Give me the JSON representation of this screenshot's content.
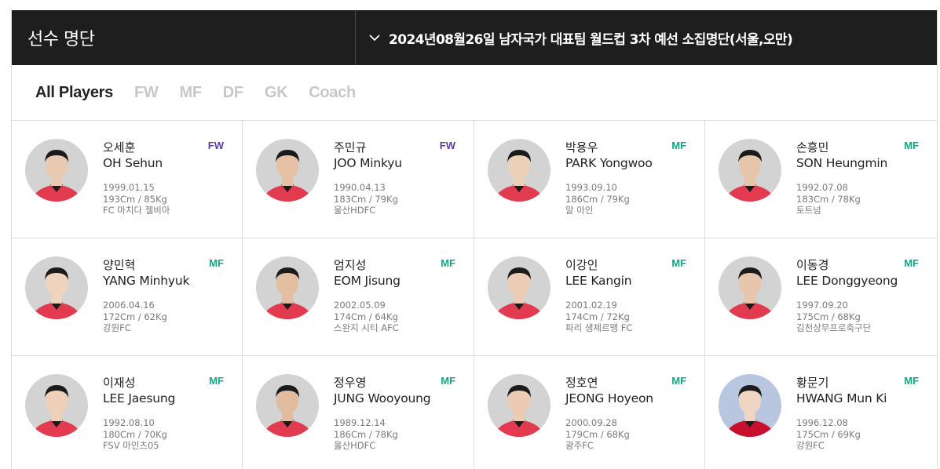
{
  "header": {
    "title": "선수 명단",
    "selected_roster": "2024년08월26일 남자국가 대표팀 월드컵 3차 예선 소집명단(서울,오만)"
  },
  "tabs": [
    "All Players",
    "FW",
    "MF",
    "DF",
    "GK",
    "Coach"
  ],
  "colors": {
    "fw": "#5b3fa0",
    "mf": "#11a683",
    "header_bg": "#1e1e1e"
  },
  "players": [
    {
      "name_ko": "오세훈",
      "name_en": "OH Sehun",
      "birth": "1999.01.15",
      "body": "193Cm / 85Kg",
      "club": "FC 마치다 젤비아",
      "position": "FW"
    },
    {
      "name_ko": "주민규",
      "name_en": "JOO Minkyu",
      "birth": "1990.04.13",
      "body": "183Cm / 79Kg",
      "club": "울산HDFC",
      "position": "FW"
    },
    {
      "name_ko": "박용우",
      "name_en": "PARK Yongwoo",
      "birth": "1993.09.10",
      "body": "186Cm / 79Kg",
      "club": "알 아인",
      "position": "MF"
    },
    {
      "name_ko": "손흥민",
      "name_en": "SON Heungmin",
      "birth": "1992.07.08",
      "body": "183Cm / 78Kg",
      "club": "토트넘",
      "position": "MF"
    },
    {
      "name_ko": "양민혁",
      "name_en": "YANG Minhyuk",
      "birth": "2006.04.16",
      "body": "172Cm / 62Kg",
      "club": "강원FC",
      "position": "MF"
    },
    {
      "name_ko": "엄지성",
      "name_en": "EOM Jisung",
      "birth": "2002.05.09",
      "body": "174Cm / 64Kg",
      "club": "스완지 시티 AFC",
      "position": "MF"
    },
    {
      "name_ko": "이강인",
      "name_en": "LEE Kangin",
      "birth": "2001.02.19",
      "body": "174Cm / 72Kg",
      "club": "파리 생제르맹 FC",
      "position": "MF"
    },
    {
      "name_ko": "이동경",
      "name_en": "LEE Donggyeong",
      "birth": "1997.09.20",
      "body": "175Cm / 68Kg",
      "club": "김천상무프로축구단",
      "position": "MF"
    },
    {
      "name_ko": "이재성",
      "name_en": "LEE Jaesung",
      "birth": "1992.08.10",
      "body": "180Cm / 70Kg",
      "club": "FSV 마인츠05",
      "position": "MF"
    },
    {
      "name_ko": "정우영",
      "name_en": "JUNG Wooyoung",
      "birth": "1989.12.14",
      "body": "186Cm / 78Kg",
      "club": "울산HDFC",
      "position": "MF"
    },
    {
      "name_ko": "정호연",
      "name_en": "JEONG Hoyeon",
      "birth": "2000.09.28",
      "body": "179Cm / 68Kg",
      "club": "광주FC",
      "position": "MF"
    },
    {
      "name_ko": "황문기",
      "name_en": "HWANG Mun Ki",
      "birth": "1996.12.08",
      "body": "175Cm / 69Kg",
      "club": "강원FC",
      "position": "MF"
    }
  ]
}
